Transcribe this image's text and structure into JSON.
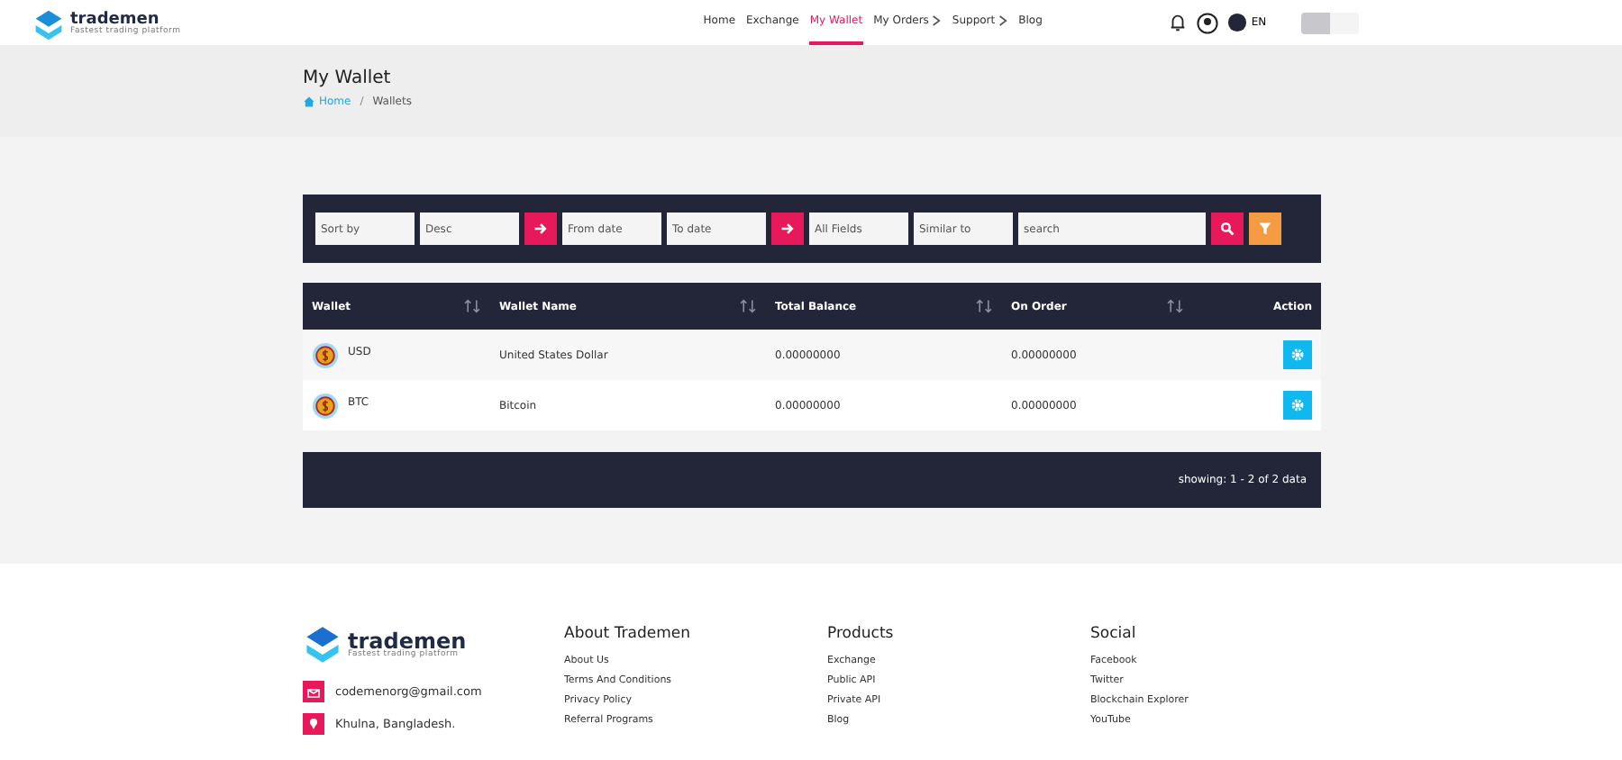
{
  "header": {
    "logo_name": "trademen",
    "logo_tagline": "Fastest trading platform",
    "nav": [
      {
        "label": "Home",
        "selected": false,
        "caret": false
      },
      {
        "label": "Exchange",
        "selected": false,
        "caret": false
      },
      {
        "label": "My Wallet",
        "selected": true,
        "caret": false
      },
      {
        "label": "My Orders",
        "selected": false,
        "caret": true
      },
      {
        "label": "Support",
        "selected": false,
        "caret": true
      },
      {
        "label": "Blog",
        "selected": false,
        "caret": false
      }
    ],
    "language": "EN",
    "theme_toggle_on": false
  },
  "page_title": "My Wallet",
  "breadcrumb_separator": "/",
  "breadcrumb": [
    {
      "label": "Home",
      "link": true
    },
    {
      "label": "Wallets",
      "link": false
    }
  ],
  "filters": [
    {
      "kind": "field",
      "placeholder": "Sort by"
    },
    {
      "kind": "field",
      "placeholder": "Desc"
    },
    {
      "kind": "go"
    },
    {
      "kind": "field",
      "placeholder": "From date"
    },
    {
      "kind": "field",
      "placeholder": "To date"
    },
    {
      "kind": "go"
    },
    {
      "kind": "field",
      "placeholder": "All Fields"
    },
    {
      "kind": "field",
      "placeholder": "Similar to"
    },
    {
      "kind": "wide",
      "placeholder": "search"
    },
    {
      "kind": "search"
    },
    {
      "kind": "filter"
    }
  ],
  "table": {
    "columns": [
      {
        "label": "Wallet",
        "sortable": true
      },
      {
        "label": "Wallet Name",
        "sortable": true
      },
      {
        "label": "Total Balance",
        "sortable": true
      },
      {
        "label": "On Order",
        "sortable": true
      },
      {
        "label": "Action",
        "sortable": false
      }
    ],
    "rows": [
      {
        "wallet": "USD",
        "name": "United States Dollar",
        "total": "0.00000000",
        "on_order": "0.00000000"
      },
      {
        "wallet": "BTC",
        "name": "Bitcoin",
        "total": "0.00000000",
        "on_order": "0.00000000"
      }
    ],
    "summary": "showing: 1 - 2 of 2 data"
  },
  "footer": {
    "logo_name": "trademen",
    "logo_tagline": "Fastest trading platform",
    "email": "codemenorg@gmail.com",
    "address": "Khulna, Bangladesh.",
    "columns": [
      {
        "title": "About Trademen",
        "links": [
          "About Us",
          "Terms And Conditions",
          "Privacy Policy",
          "Referral Programs"
        ]
      },
      {
        "title": "Products",
        "links": [
          "Exchange",
          "Public API",
          "Private API",
          "Blog"
        ]
      },
      {
        "title": "Social",
        "links": [
          "Facebook",
          "Twitter",
          "Blockchain Explorer",
          "YouTube"
        ]
      }
    ]
  }
}
